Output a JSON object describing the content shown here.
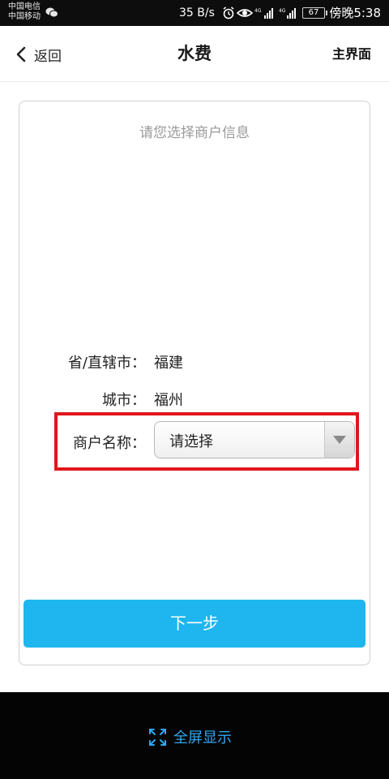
{
  "status_bar": {
    "carrier_1": "中国电信",
    "carrier_2": "中国移动",
    "network_speed": "35 B/s",
    "signal_1_tag": "4G",
    "signal_2_tag": "4G",
    "battery": "67",
    "time": "傍晚5:38",
    "icons": [
      "wechat-icon",
      "alarm-icon",
      "eye-icon",
      "signal-icon",
      "battery-icon"
    ]
  },
  "header": {
    "back_label": "返回",
    "title": "水费",
    "home_label": "主界面"
  },
  "card": {
    "hint": "请您选择商户信息",
    "province_label": "省/直辖市：",
    "province_value": "福建",
    "city_label": "城市：",
    "city_value": "福州",
    "merchant_label": "商户名称：",
    "merchant_select_value": "请选择",
    "next_label": "下一步"
  },
  "bottom_bar": {
    "fullscreen_label": "全屏显示"
  },
  "colors": {
    "accent": "#1fb5ee",
    "highlight": "#e0161c",
    "fullscreen_text": "#2fa8f0"
  }
}
